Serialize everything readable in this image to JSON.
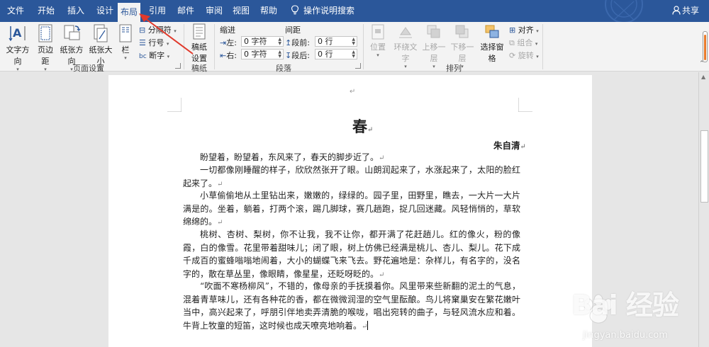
{
  "tabs": [
    {
      "label": "文件",
      "active": false
    },
    {
      "label": "开始",
      "active": false
    },
    {
      "label": "插入",
      "active": false
    },
    {
      "label": "设计",
      "active": false
    },
    {
      "label": "布局",
      "active": true
    },
    {
      "label": "引用",
      "active": false
    },
    {
      "label": "邮件",
      "active": false
    },
    {
      "label": "审阅",
      "active": false
    },
    {
      "label": "视图",
      "active": false
    },
    {
      "label": "帮助",
      "active": false
    }
  ],
  "tell_me": "操作说明搜索",
  "share": "共享",
  "colors": {
    "brand": "#2b579a",
    "annotation": "#e0392b"
  },
  "ribbon": {
    "page_setup": {
      "text_direction": "文字方向",
      "margins": "页边距",
      "orientation": "纸张方向",
      "size": "纸张大小",
      "columns": "栏",
      "breaks": "分隔符",
      "line_numbers": "行号",
      "hyphenation": "断字",
      "group_label": "页面设置"
    },
    "manuscript": {
      "setup_line1": "稿纸",
      "setup_line2": "设置",
      "group_label": "稿纸"
    },
    "paragraph": {
      "indent_header": "缩进",
      "spacing_header": "间距",
      "left_label": "左:",
      "right_label": "右:",
      "left_value": "0 字符",
      "right_value": "0 字符",
      "before_label": "段前:",
      "after_label": "段后:",
      "before_value": "0 行",
      "after_value": "0 行",
      "group_label": "段落"
    },
    "arrange": {
      "position": "位置",
      "wrap_text": "环绕文字",
      "bring_forward": "上移一层",
      "send_backward": "下移一层",
      "selection_pane": "选择窗格",
      "align": "对齐",
      "group": "组合",
      "rotate": "旋转",
      "group_label": "排列"
    }
  },
  "document": {
    "title": "春",
    "author": "朱自清",
    "paragraphs": [
      "盼望着，盼望着，东风来了，春天的脚步近了。",
      "一切都像刚睡醒的样子，欣欣然张开了眼。山朗润起来了，水涨起来了，太阳的脸红起来了。",
      "小草偷偷地从土里钻出来，嫩嫩的，绿绿的。园子里，田野里，瞧去，一大片一大片满是的。坐着，躺着，打两个滚，踢几脚球，赛几趟跑，捉几回迷藏。风轻悄悄的，草软绵绵的。",
      "桃树、杏树、梨树，你不让我，我不让你，都开满了花赶趟儿。红的像火，粉的像霞，白的像雪。花里带着甜味儿；闭了眼，树上仿佛已经满是桃儿、杏儿、梨儿。花下成千成百的蜜蜂嗡嗡地闹着，大小的蝴蝶飞来飞去。野花遍地是：杂样儿，有名字的，没名字的，散在草丛里，像眼睛，像星星，还眨呀眨的。",
      "“吹面不寒杨柳风”，不错的，像母亲的手抚摸着你。风里带来些新翻的泥土的气息，混着青草味儿，还有各种花的香，都在微微润湿的空气里酝酿。鸟儿将窠巢安在繁花嫩叶当中，高兴起来了，呼朋引伴地卖弄清脆的喉咙，唱出宛转的曲子，与轻风流水应和着。牛背上牧童的短笛，这时候也成天嘹亮地响着。"
    ]
  },
  "watermark": {
    "brand": "Bai 经验",
    "url": "jingyan.baidu.com"
  }
}
